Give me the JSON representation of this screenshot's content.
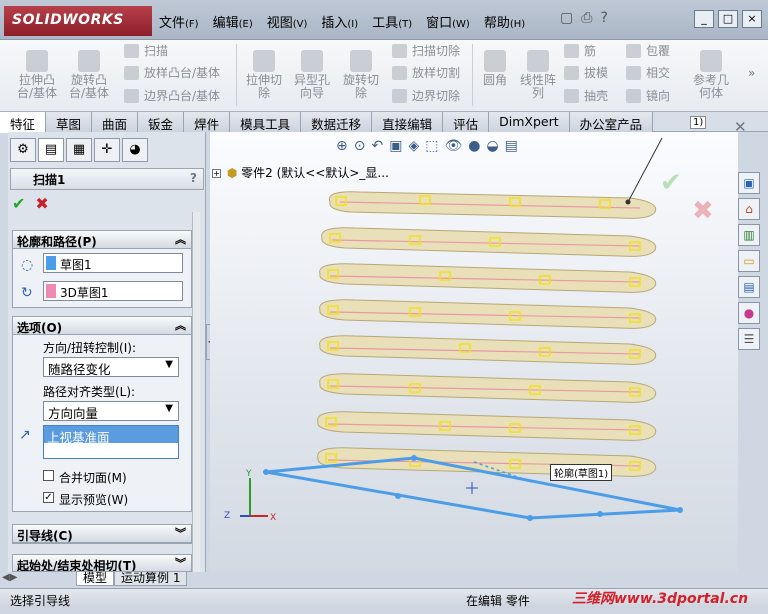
{
  "app": {
    "name": "SOLIDWORKS"
  },
  "menu": [
    {
      "label": "文件",
      "key": "(F)"
    },
    {
      "label": "编辑",
      "key": "(E)"
    },
    {
      "label": "视图",
      "key": "(V)"
    },
    {
      "label": "插入",
      "key": "(I)"
    },
    {
      "label": "工具",
      "key": "(T)"
    },
    {
      "label": "窗口",
      "key": "(W)"
    },
    {
      "label": "帮助",
      "key": "(H)"
    }
  ],
  "window_buttons": [
    "_",
    "□",
    "×"
  ],
  "ribbon": {
    "extrude_boss": "拉伸凸\n台/基体",
    "revolve_boss": "旋转凸\n台/基体",
    "sweep": "扫描",
    "loft_boss": "放样凸台/基体",
    "boundary_boss": "边界凸台/基体",
    "extrude_cut": "拉伸切\n除",
    "hole_wizard": "异型孔\n向导",
    "revolve_cut": "旋转切\n除",
    "sweep_cut": "扫描切除",
    "loft_cut": "放样切割",
    "boundary_cut": "边界切除",
    "fillet": "圆角",
    "linear_pattern": "线性阵\n列",
    "rib": "筋",
    "draft": "拔模",
    "shell": "抽壳",
    "wrap": "包覆",
    "intersect": "相交",
    "mirror": "镜向",
    "ref_geometry": "参考几\n何体"
  },
  "tabs": [
    "特征",
    "草图",
    "曲面",
    "钣金",
    "焊件",
    "模具工具",
    "数据迁移",
    "直接编辑",
    "评估",
    "DimXpert",
    "办公室产品"
  ],
  "active_tab": "特征",
  "panel": {
    "feature_title": "扫描1",
    "help": "?",
    "profile_section": {
      "title": "轮廓和路径(P)",
      "profile_value": "草图1",
      "path_value": "3D草图1",
      "profile_color": "#4a9de6",
      "path_color": "#f08ab4"
    },
    "options_section": {
      "title": "选项(O)",
      "orientation_label": "方向/扭转控制(I):",
      "orientation_value": "随路径变化",
      "alignment_label": "路径对齐类型(L):",
      "alignment_value": "方向向量",
      "direction_value": "上视基准面",
      "merge_faces": "合并切面(M)",
      "show_preview": "显示预览(W)"
    },
    "guide_section": {
      "title": "引导线(C)"
    },
    "tangency_section": {
      "title": "起始处/结束处相切(T)"
    }
  },
  "tree_line": "零件2 (默认<<默认>_显...",
  "callout": {
    "text": "轮廓(草图1)"
  },
  "ruler_tag": "1)",
  "bottom_tabs": [
    "模型",
    "运动算例 1"
  ],
  "status": {
    "hint": "选择引导线",
    "mode": "在编辑 零件"
  },
  "watermark": "三维网www.3dportal.cn"
}
